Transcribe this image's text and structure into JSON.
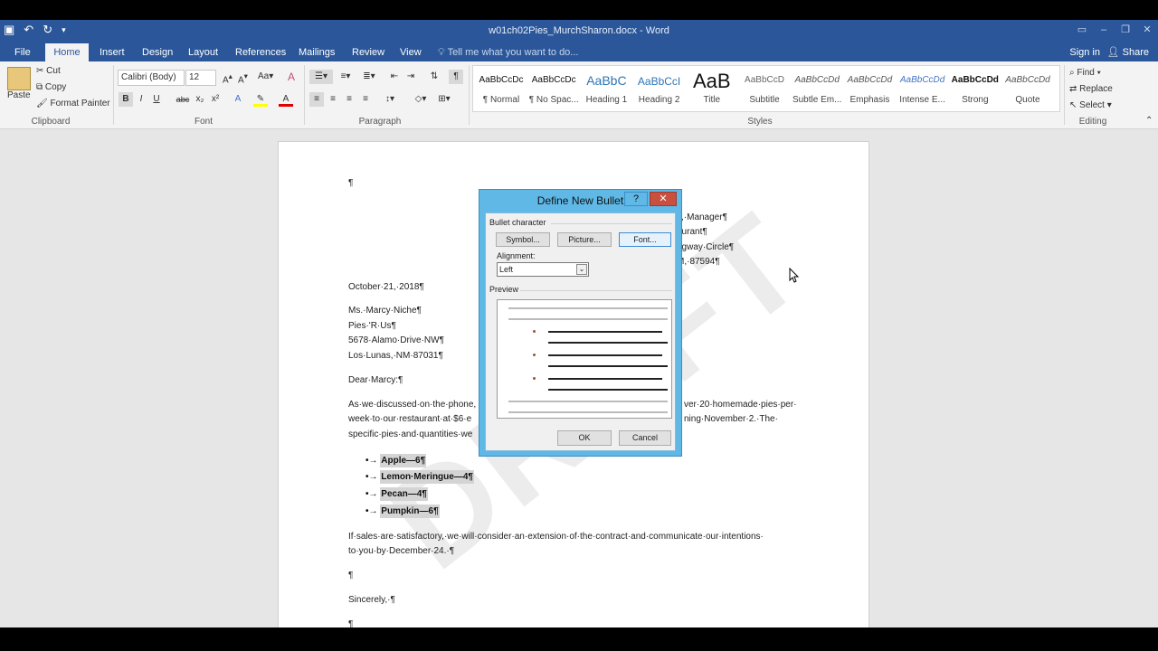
{
  "window": {
    "title": "w01ch02Pies_MurchSharon.docx - Word"
  },
  "tabs": [
    "File",
    "Home",
    "Insert",
    "Design",
    "Layout",
    "References",
    "Mailings",
    "Review",
    "View"
  ],
  "tell_me": "Tell me what you want to do...",
  "account": {
    "sign_in": "Sign in",
    "share": "Share"
  },
  "clipboard": {
    "paste": "Paste",
    "cut": "Cut",
    "copy": "Copy",
    "format_painter": "Format Painter",
    "label": "Clipboard"
  },
  "font": {
    "name": "Calibri (Body)",
    "size": "12",
    "label": "Font",
    "bold": "B",
    "italic": "I",
    "underline": "U",
    "strike": "abc",
    "sub": "x₂",
    "sup": "x²"
  },
  "paragraph": {
    "label": "Paragraph"
  },
  "styles": {
    "label": "Styles",
    "items": [
      {
        "sample": "AaBbCcDc",
        "name": "¶ Normal"
      },
      {
        "sample": "AaBbCcDc",
        "name": "¶ No Spac..."
      },
      {
        "sample": "AaBbC",
        "name": "Heading 1"
      },
      {
        "sample": "AaBbCcI",
        "name": "Heading 2"
      },
      {
        "sample": "AaB",
        "name": "Title"
      },
      {
        "sample": "AaBbCcD",
        "name": "Subtitle"
      },
      {
        "sample": "AaBbCcDd",
        "name": "Subtle Em..."
      },
      {
        "sample": "AaBbCcDd",
        "name": "Emphasis"
      },
      {
        "sample": "AaBbCcDd",
        "name": "Intense E..."
      },
      {
        "sample": "AaBbCcDd",
        "name": "Strong"
      },
      {
        "sample": "AaBbCcDd",
        "name": "Quote"
      }
    ]
  },
  "editing": {
    "find": "Find",
    "replace": "Replace",
    "select": "Select",
    "label": "Editing"
  },
  "document": {
    "watermark": "DRAFT",
    "pilcrow_top": "¶",
    "sender": [
      "s,·Manager¶",
      "aurant¶",
      "ngway·Circle¶",
      "M,·87594¶"
    ],
    "date": "October·21,·2018¶",
    "recipient": [
      "Ms.·Marcy·Niche¶",
      "Pies·'R·Us¶",
      "5678·Alamo·Drive·NW¶",
      "Los·Lunas,·NM·87031¶"
    ],
    "salutation": "Dear·Marcy:¶",
    "body1_left": [
      "As·we·discussed·on·the·phone,",
      "week·to·our·restaurant·at·$6·e",
      "specific·pies·and·quantities·we"
    ],
    "body1_right": [
      "ver·20·homemade·pies·per·",
      "ning·November·2.·The·"
    ],
    "bullets": [
      "Apple—6¶",
      "Lemon·Meringue—4¶",
      "Pecan—4¶",
      "Pumpkin—6¶"
    ],
    "body2": [
      "If·sales·are·satisfactory,·we·will·consider·an·extension·of·the·contract·and·communicate·our·intentions·",
      "to·you·by·December·24.·¶"
    ],
    "blank": "¶",
    "closing": "Sincerely,·¶",
    "blank2": "¶"
  },
  "dialog": {
    "title": "Define New Bullet",
    "help": "?",
    "close": "✕",
    "bullet_character": "Bullet character",
    "symbol_button": "Symbol...",
    "picture_button": "Picture...",
    "font_button": "Font...",
    "alignment_label": "Alignment:",
    "alignment_value": "Left",
    "preview_label": "Preview",
    "ok": "OK",
    "cancel": "Cancel"
  }
}
